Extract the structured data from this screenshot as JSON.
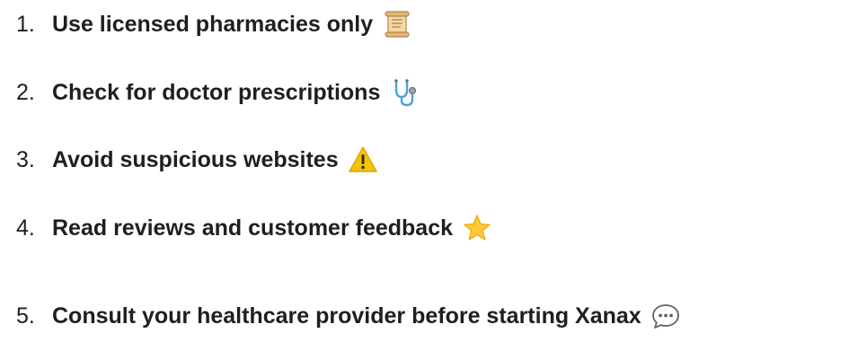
{
  "list": {
    "items": [
      {
        "number": "1.",
        "text": "Use licensed pharmacies only",
        "icon": "scroll-icon"
      },
      {
        "number": "2.",
        "text": "Check for doctor prescriptions",
        "icon": "stethoscope-icon"
      },
      {
        "number": "3.",
        "text": "Avoid suspicious websites",
        "icon": "warning-icon"
      },
      {
        "number": "4.",
        "text": "Read reviews and customer feedback",
        "icon": "star-icon"
      },
      {
        "number": "5.",
        "text": "Consult your healthcare provider before starting Xanax",
        "icon": "speech-bubble-icon"
      }
    ]
  },
  "colors": {
    "text": "#1f1f1f",
    "scroll": "#f2d9a6",
    "stethoscope": "#4aa3df",
    "warning": "#f4c20d",
    "star": "#ffc83d"
  }
}
